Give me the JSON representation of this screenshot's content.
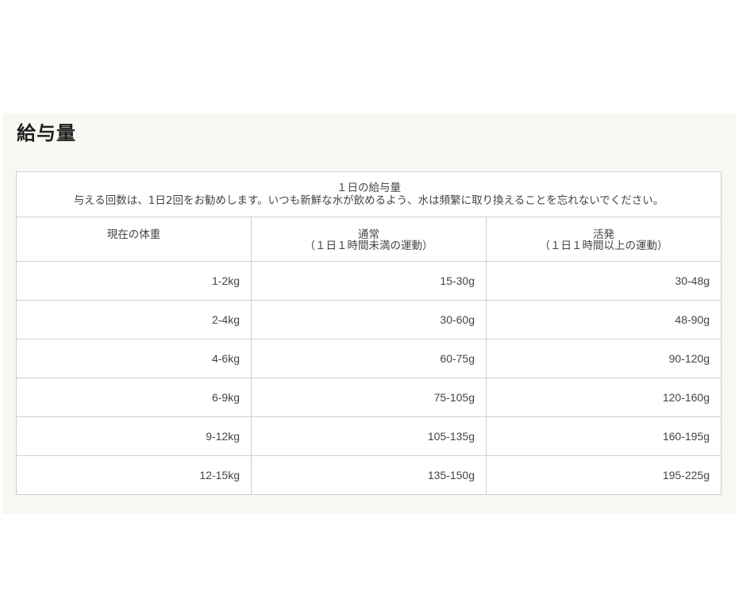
{
  "section": {
    "title": "給与量"
  },
  "table": {
    "caption_line1": "１日の給与量",
    "caption_line2": "与える回数は、1日2回をお勧めします。いつも新鮮な水が飲めるよう、水は頻繁に取り換えることを忘れないでください。",
    "headers": [
      {
        "line1": "現在の体重",
        "line2": ""
      },
      {
        "line1": "通常",
        "line2": "（１日１時間未満の運動）"
      },
      {
        "line1": "活発",
        "line2": "（１日１時間以上の運動）"
      }
    ],
    "rows": [
      [
        "1-2kg",
        "15-30g",
        "30-48g"
      ],
      [
        "2-4kg",
        "30-60g",
        "48-90g"
      ],
      [
        "4-6kg",
        "60-75g",
        "90-120g"
      ],
      [
        "6-9kg",
        "75-105g",
        "120-160g"
      ],
      [
        "9-12kg",
        "105-135g",
        "160-195g"
      ],
      [
        "12-15kg",
        "135-150g",
        "195-225g"
      ]
    ]
  }
}
